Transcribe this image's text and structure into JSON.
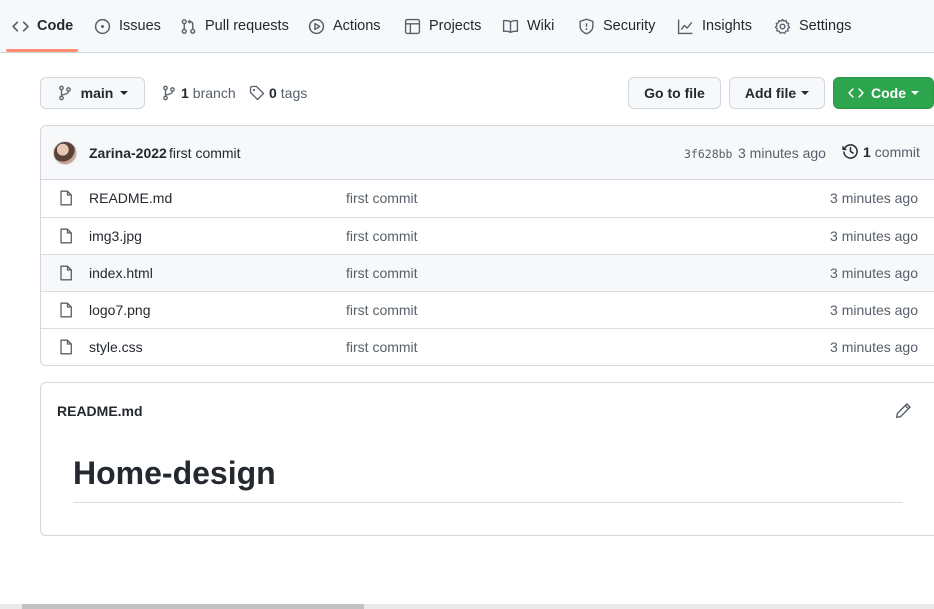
{
  "nav": {
    "items": [
      {
        "label": "Code",
        "icon": "code-icon",
        "active": true
      },
      {
        "label": "Issues",
        "icon": "issue-opened-icon"
      },
      {
        "label": "Pull requests",
        "icon": "git-pull-request-icon"
      },
      {
        "label": "Actions",
        "icon": "play-icon"
      },
      {
        "label": "Projects",
        "icon": "table-icon"
      },
      {
        "label": "Wiki",
        "icon": "book-icon"
      },
      {
        "label": "Security",
        "icon": "shield-icon"
      },
      {
        "label": "Insights",
        "icon": "graph-icon"
      },
      {
        "label": "Settings",
        "icon": "gear-icon"
      }
    ],
    "underline_color": "#fd8c73"
  },
  "branch_bar": {
    "branch_name": "main",
    "branch_count": "1",
    "branch_label": "branch",
    "tag_count": "0",
    "tag_label": "tags",
    "go_to_file": "Go to file",
    "add_file": "Add file",
    "code_button": "Code",
    "code_button_color": "#2da44e"
  },
  "latest_commit": {
    "author": "Zarina-2022",
    "message": "first commit",
    "sha": "3f628bb",
    "time": "3 minutes ago",
    "count": "1",
    "count_label": "commit"
  },
  "files": [
    {
      "name": "README.md",
      "commit": "first commit",
      "age": "3 minutes ago"
    },
    {
      "name": "img3.jpg",
      "commit": "first commit",
      "age": "3 minutes ago"
    },
    {
      "name": "index.html",
      "commit": "first commit",
      "age": "3 minutes ago"
    },
    {
      "name": "logo7.png",
      "commit": "first commit",
      "age": "3 minutes ago"
    },
    {
      "name": "style.css",
      "commit": "first commit",
      "age": "3 minutes ago"
    }
  ],
  "readme": {
    "filename": "README.md",
    "heading": "Home-design"
  }
}
